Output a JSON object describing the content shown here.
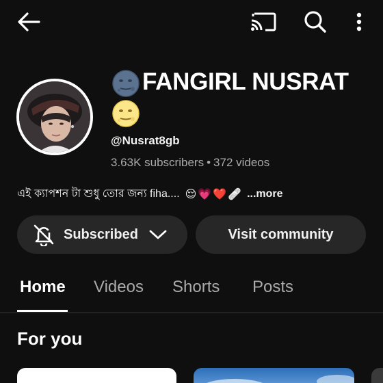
{
  "header": {
    "back_icon": "arrow-left-icon",
    "cast_icon": "cast-icon",
    "search_icon": "search-icon",
    "more_icon": "more-vertical-icon"
  },
  "channel": {
    "name": "FANGIRL NUSRAT",
    "name_prefix_emoji": "new-moon-face",
    "name_suffix_emoji": "full-moon-face",
    "handle": "@Nusrat8gb",
    "subscribers": "3.63K subscribers",
    "separator": "•",
    "videos": "372 videos",
    "description": "এই ক্যাপশন টা শুধু তোর জন্য fiha....",
    "description_emojis": [
      "😌",
      "💗",
      "❤️",
      "🩹"
    ],
    "more_label": "...more"
  },
  "actions": {
    "subscribed_label": "Subscribed",
    "community_label": "Visit community"
  },
  "tabs": [
    {
      "label": "Home",
      "active": true
    },
    {
      "label": "Videos",
      "active": false
    },
    {
      "label": "Shorts",
      "active": false
    },
    {
      "label": "Posts",
      "active": false
    }
  ],
  "section": {
    "title": "For you"
  },
  "colors": {
    "background": "#0f0f0f",
    "button_bg": "#272727",
    "secondary_text": "#aaaaaa",
    "primary_text": "#ffffff"
  }
}
